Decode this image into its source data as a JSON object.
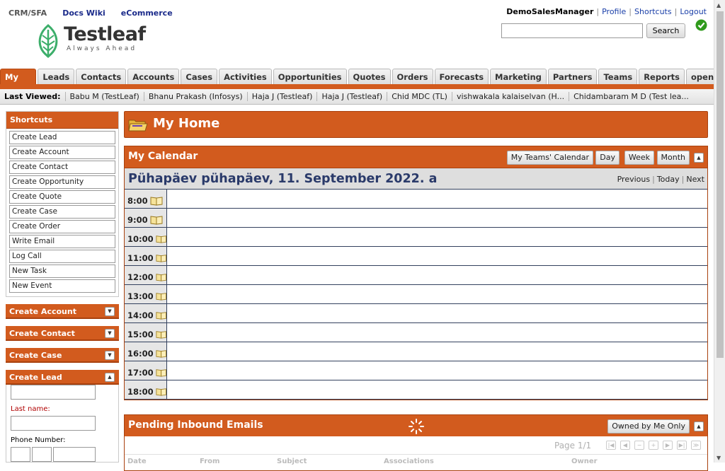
{
  "header": {
    "app_label": "CRM/SFA",
    "links": [
      "Docs Wiki",
      "eCommerce"
    ],
    "logo_name": "Testleaf",
    "logo_tagline": "Always Ahead",
    "user": "DemoSalesManager",
    "user_links": [
      "Profile",
      "Shortcuts",
      "Logout"
    ],
    "search_placeholder": "",
    "search_button": "Search"
  },
  "tabs": [
    "My Home",
    "Leads",
    "Contacts",
    "Accounts",
    "Cases",
    "Activities",
    "Opportunities",
    "Quotes",
    "Orders",
    "Forecasts",
    "Marketing",
    "Partners",
    "Teams",
    "Reports",
    "opentaps"
  ],
  "active_tab": "My Home",
  "last_viewed": {
    "label": "Last Viewed:",
    "items": [
      "Babu M (TestLeaf)",
      "Bhanu Prakash (Infosys)",
      "Haja J (Testleaf)",
      "Haja J (Testleaf)",
      "Chid MDC (TL)",
      "vishwakala kalaiselvan (H...",
      "Chidambaram M D (Test lea..."
    ]
  },
  "sidebar": {
    "shortcuts_title": "Shortcuts",
    "shortcuts": [
      "Create Lead",
      "Create Account",
      "Create Contact",
      "Create Opportunity",
      "Create Quote",
      "Create Case",
      "Create Order",
      "Write Email",
      "Log Call",
      "New Task",
      "New Event"
    ],
    "panels": [
      "Create Account",
      "Create Contact",
      "Create Case",
      "Create Lead"
    ],
    "lead_form": {
      "last_name_label": "Last name:",
      "phone_label": "Phone Number:"
    }
  },
  "main": {
    "page_title": "My Home",
    "calendar": {
      "title": "My Calendar",
      "buttons": [
        "My Teams' Calendar",
        "Day",
        "Week",
        "Month"
      ],
      "date": "Pühapäev pühapäev, 11. September 2022. a",
      "nav": [
        "Previous",
        "Today",
        "Next"
      ],
      "hours": [
        "8:00",
        "9:00",
        "10:00",
        "11:00",
        "12:00",
        "13:00",
        "14:00",
        "15:00",
        "16:00",
        "17:00",
        "18:00"
      ]
    },
    "emails": {
      "title": "Pending Inbound Emails",
      "filter_button": "Owned by Me Only",
      "pager": "Page 1/1",
      "columns": [
        "Date",
        "From",
        "Subject",
        "Associations",
        "Owner"
      ]
    }
  },
  "colors": {
    "accent": "#d25b1e",
    "accent_dark": "#a9410e",
    "link": "#1a3fa8"
  }
}
